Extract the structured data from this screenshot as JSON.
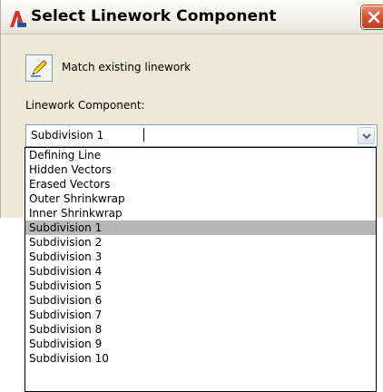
{
  "window": {
    "title": "Select Linework Component",
    "close_symbol": "✕"
  },
  "match_existing": {
    "label": "Match existing linework",
    "icon": "pencil-icon"
  },
  "component": {
    "label": "Linework Component:",
    "selected_value": "Subdivision 1",
    "options": [
      "Defining Line",
      "Hidden Vectors",
      "Erased Vectors",
      "Outer Shrinkwrap",
      "Inner Shrinkwrap",
      "Subdivision 1",
      "Subdivision 2",
      "Subdivision 3",
      "Subdivision 4",
      "Subdivision 5",
      "Subdivision 6",
      "Subdivision 7",
      "Subdivision 8",
      "Subdivision 9",
      "Subdivision 10"
    ],
    "highlighted_index": 5
  },
  "colors": {
    "dialog_background": "#ece9d8",
    "selection_highlight": "#b8b7b7",
    "close_button": "#d6573a",
    "field_border": "#7f9db9"
  }
}
